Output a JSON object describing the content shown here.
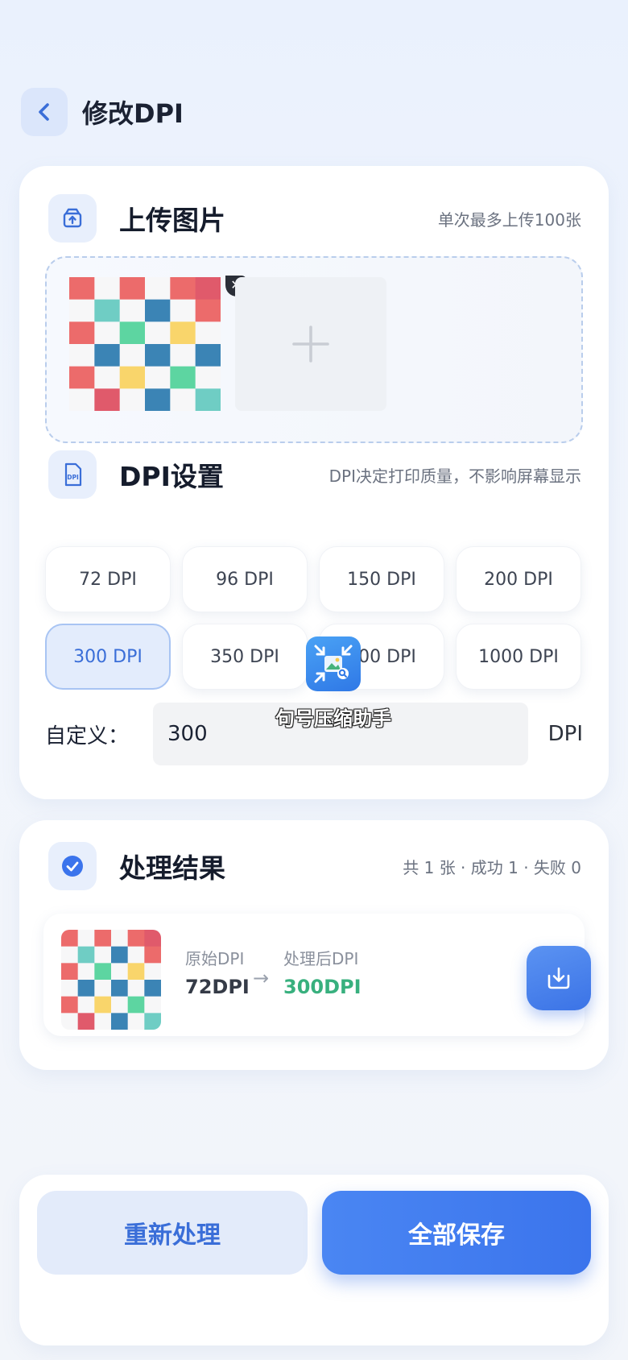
{
  "header": {
    "title": "修改DPI",
    "back_icon": "chevron-left-icon"
  },
  "upload": {
    "title": "上传图片",
    "note": "单次最多上传100张",
    "icon": "upload-box-icon",
    "remove_glyph": "✕",
    "add_icon": "plus-icon"
  },
  "dpi_settings": {
    "title": "DPI设置",
    "note": "DPI决定打印质量，不影响屏幕显示",
    "icon": "dpi-file-icon",
    "options": [
      "72 DPI",
      "96 DPI",
      "150 DPI",
      "200 DPI",
      "300 DPI",
      "350 DPI",
      "500 DPI",
      "1000 DPI"
    ],
    "selected": "300 DPI",
    "custom_label": "自定义：",
    "custom_value": "300",
    "custom_unit": "DPI"
  },
  "watermark": {
    "text": "句号压缩助手",
    "icon": "image-compress-icon"
  },
  "results": {
    "title": "处理结果",
    "summary": "共 1 张 · 成功 1 · 失败 0",
    "icon": "check-circle-icon",
    "item": {
      "original_label": "原始DPI",
      "original_value": "72DPI",
      "processed_label": "处理后DPI",
      "processed_value": "300DPI",
      "arrow": "→",
      "download_icon": "download-icon"
    }
  },
  "actions": {
    "redo_label": "重新处理",
    "save_label": "全部保存"
  },
  "colors": {
    "accent": "#3b74ec",
    "success": "#38b07e",
    "selected_bg": "#e3ecfc"
  },
  "checker_colors": [
    "#ec6b6b",
    "#6fcdc4",
    "#3b84b5",
    "#5dd5a1",
    "#f9d56b",
    "#e05a6b"
  ]
}
